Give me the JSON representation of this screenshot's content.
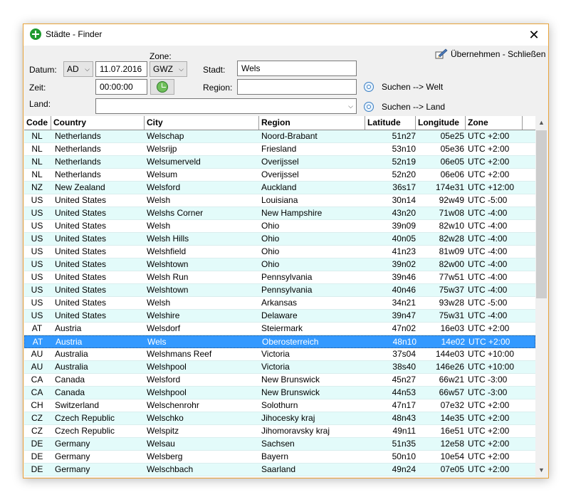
{
  "window": {
    "title": "Städte - Finder",
    "close_glyph": "✕"
  },
  "toolbar": {
    "apply_close": "Übernehmen - Schließen",
    "apply_icon": "edit-icon"
  },
  "form": {
    "datum_label": "Datum:",
    "era": "AD",
    "date": "11.07.2016",
    "zone_label": "Zone:",
    "zone": "GWZ",
    "stadt_label": "Stadt:",
    "stadt_value": "Wels",
    "zeit_label": "Zeit:",
    "zeit_value": "00:00:00",
    "region_label": "Region:",
    "region_value": "",
    "land_label": "Land:",
    "land_value": "",
    "search_world": "Suchen --> Welt",
    "search_country": "Suchen --> Land"
  },
  "table": {
    "headers": {
      "code": "Code",
      "country": "Country",
      "city": "City",
      "region": "Region",
      "lat": "Latitude",
      "lon": "Longitude",
      "zone": "Zone"
    },
    "selected_index": 16,
    "rows": [
      [
        "NL",
        "Netherlands",
        "Welschap",
        "Noord-Brabant",
        "51n27",
        "05e25",
        "UTC +2:00"
      ],
      [
        "NL",
        "Netherlands",
        "Welsrijp",
        "Friesland",
        "53n10",
        "05e36",
        "UTC +2:00"
      ],
      [
        "NL",
        "Netherlands",
        "Welsumerveld",
        "Overijssel",
        "52n19",
        "06e05",
        "UTC +2:00"
      ],
      [
        "NL",
        "Netherlands",
        "Welsum",
        "Overijssel",
        "52n20",
        "06e06",
        "UTC +2:00"
      ],
      [
        "NZ",
        "New Zealand",
        "Welsford",
        "Auckland",
        "36s17",
        "174e31",
        "UTC +12:00"
      ],
      [
        "US",
        "United States",
        "Welsh",
        "Louisiana",
        "30n14",
        "92w49",
        "UTC -5:00"
      ],
      [
        "US",
        "United States",
        "Welshs Corner",
        "New Hampshire",
        "43n20",
        "71w08",
        "UTC -4:00"
      ],
      [
        "US",
        "United States",
        "Welsh",
        "Ohio",
        "39n09",
        "82w10",
        "UTC -4:00"
      ],
      [
        "US",
        "United States",
        "Welsh Hills",
        "Ohio",
        "40n05",
        "82w28",
        "UTC -4:00"
      ],
      [
        "US",
        "United States",
        "Welshfield",
        "Ohio",
        "41n23",
        "81w09",
        "UTC -4:00"
      ],
      [
        "US",
        "United States",
        "Welshtown",
        "Ohio",
        "39n02",
        "82w00",
        "UTC -4:00"
      ],
      [
        "US",
        "United States",
        "Welsh Run",
        "Pennsylvania",
        "39n46",
        "77w51",
        "UTC -4:00"
      ],
      [
        "US",
        "United States",
        "Welshtown",
        "Pennsylvania",
        "40n46",
        "75w37",
        "UTC -4:00"
      ],
      [
        "US",
        "United States",
        "Welsh",
        "Arkansas",
        "34n21",
        "93w28",
        "UTC -5:00"
      ],
      [
        "US",
        "United States",
        "Welshire",
        "Delaware",
        "39n47",
        "75w31",
        "UTC -4:00"
      ],
      [
        "AT",
        "Austria",
        "Welsdorf",
        "Steiermark",
        "47n02",
        "16e03",
        "UTC +2:00"
      ],
      [
        "AT",
        "Austria",
        "Wels",
        "Oberosterreich",
        "48n10",
        "14e02",
        "UTC +2:00"
      ],
      [
        "AU",
        "Australia",
        "Welshmans Reef",
        "Victoria",
        "37s04",
        "144e03",
        "UTC +10:00"
      ],
      [
        "AU",
        "Australia",
        "Welshpool",
        "Victoria",
        "38s40",
        "146e26",
        "UTC +10:00"
      ],
      [
        "CA",
        "Canada",
        "Welsford",
        "New Brunswick",
        "45n27",
        "66w21",
        "UTC -3:00"
      ],
      [
        "CA",
        "Canada",
        "Welshpool",
        "New Brunswick",
        "44n53",
        "66w57",
        "UTC -3:00"
      ],
      [
        "CH",
        "Switzerland",
        "Welschenrohr",
        "Solothurn",
        "47n17",
        "07e32",
        "UTC +2:00"
      ],
      [
        "CZ",
        "Czech Republic",
        "Welschko",
        "Jihocesky kraj",
        "48n43",
        "14e35",
        "UTC +2:00"
      ],
      [
        "CZ",
        "Czech Republic",
        "Welspitz",
        "Jihomoravsky kraj",
        "49n11",
        "16e51",
        "UTC +2:00"
      ],
      [
        "DE",
        "Germany",
        "Welsau",
        "Sachsen",
        "51n35",
        "12e58",
        "UTC +2:00"
      ],
      [
        "DE",
        "Germany",
        "Welsberg",
        "Bayern",
        "50n10",
        "10e54",
        "UTC +2:00"
      ],
      [
        "DE",
        "Germany",
        "Welschbach",
        "Saarland",
        "49n24",
        "07e05",
        "UTC +2:00"
      ]
    ]
  },
  "scrollbar": {
    "up_glyph": "▲",
    "down_glyph": "▼"
  }
}
